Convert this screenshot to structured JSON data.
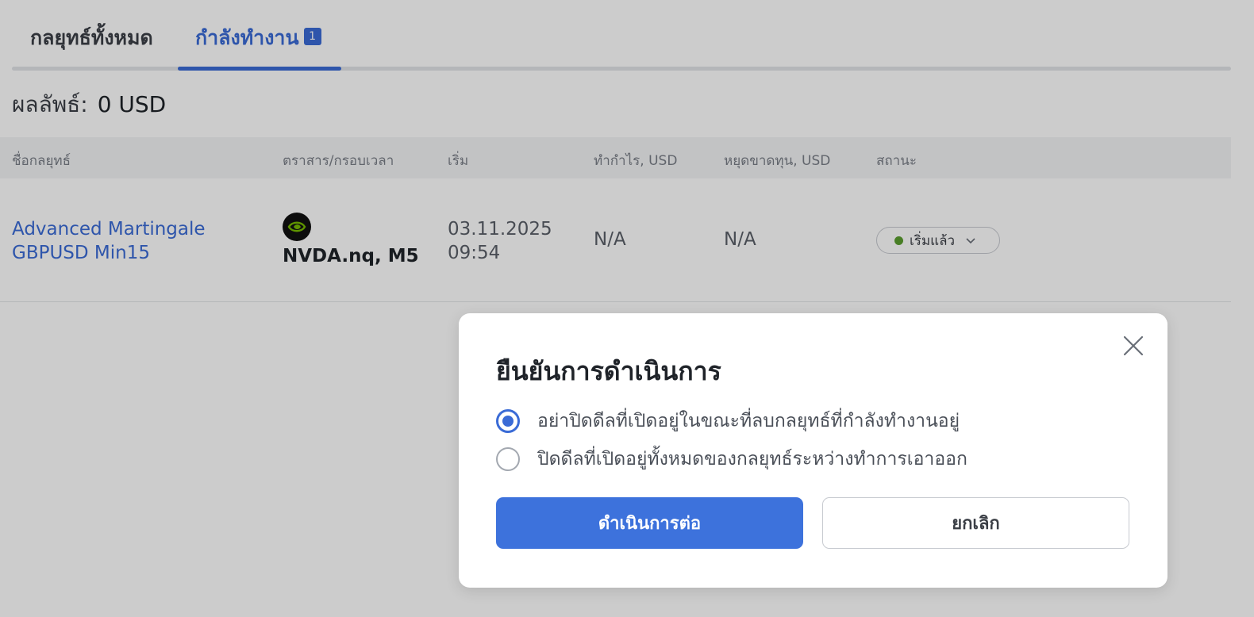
{
  "tabs": {
    "all_label": "กลยุทธ์ทั้งหมด",
    "active_label": "กำลังทำงาน",
    "active_count": "1"
  },
  "result": {
    "label": "ผลลัพธ์:",
    "value": "0 USD"
  },
  "table": {
    "headers": [
      "ชื่อกลยุทธ์",
      "ตราสาร/กรอบเวลา",
      "เริ่ม",
      "ทำกำไร, USD",
      "หยุดขาดทุน, USD",
      "สถานะ"
    ],
    "rows": [
      {
        "name_line1": "Advanced Martingale",
        "name_line2": "GBPUSD Min15",
        "symbol_icon": "nvidia-logo-icon",
        "symbol": "NVDA.nq, M5",
        "start_date": "03.11.2025",
        "start_time": "09:54",
        "take_profit": "N/A",
        "stop_loss": "N/A",
        "status": "เริ่มแล้ว",
        "status_color": "#5a9e2f"
      }
    ]
  },
  "modal": {
    "title": "ยืนยันการดำเนินการ",
    "options": [
      {
        "label": "อย่าปิดดีลที่เปิดอยู่ในขณะที่ลบกลยุทธ์ที่กำลังทำงานอยู่",
        "checked": true
      },
      {
        "label": "ปิดดีลที่เปิดอยู่ทั้งหมดของกลยุทธ์ระหว่างทำการเอาออก",
        "checked": false
      }
    ],
    "continue_label": "ดำเนินการต่อ",
    "cancel_label": "ยกเลิก"
  },
  "colors": {
    "accent": "#3a6bd6",
    "button": "#3d72dc"
  }
}
